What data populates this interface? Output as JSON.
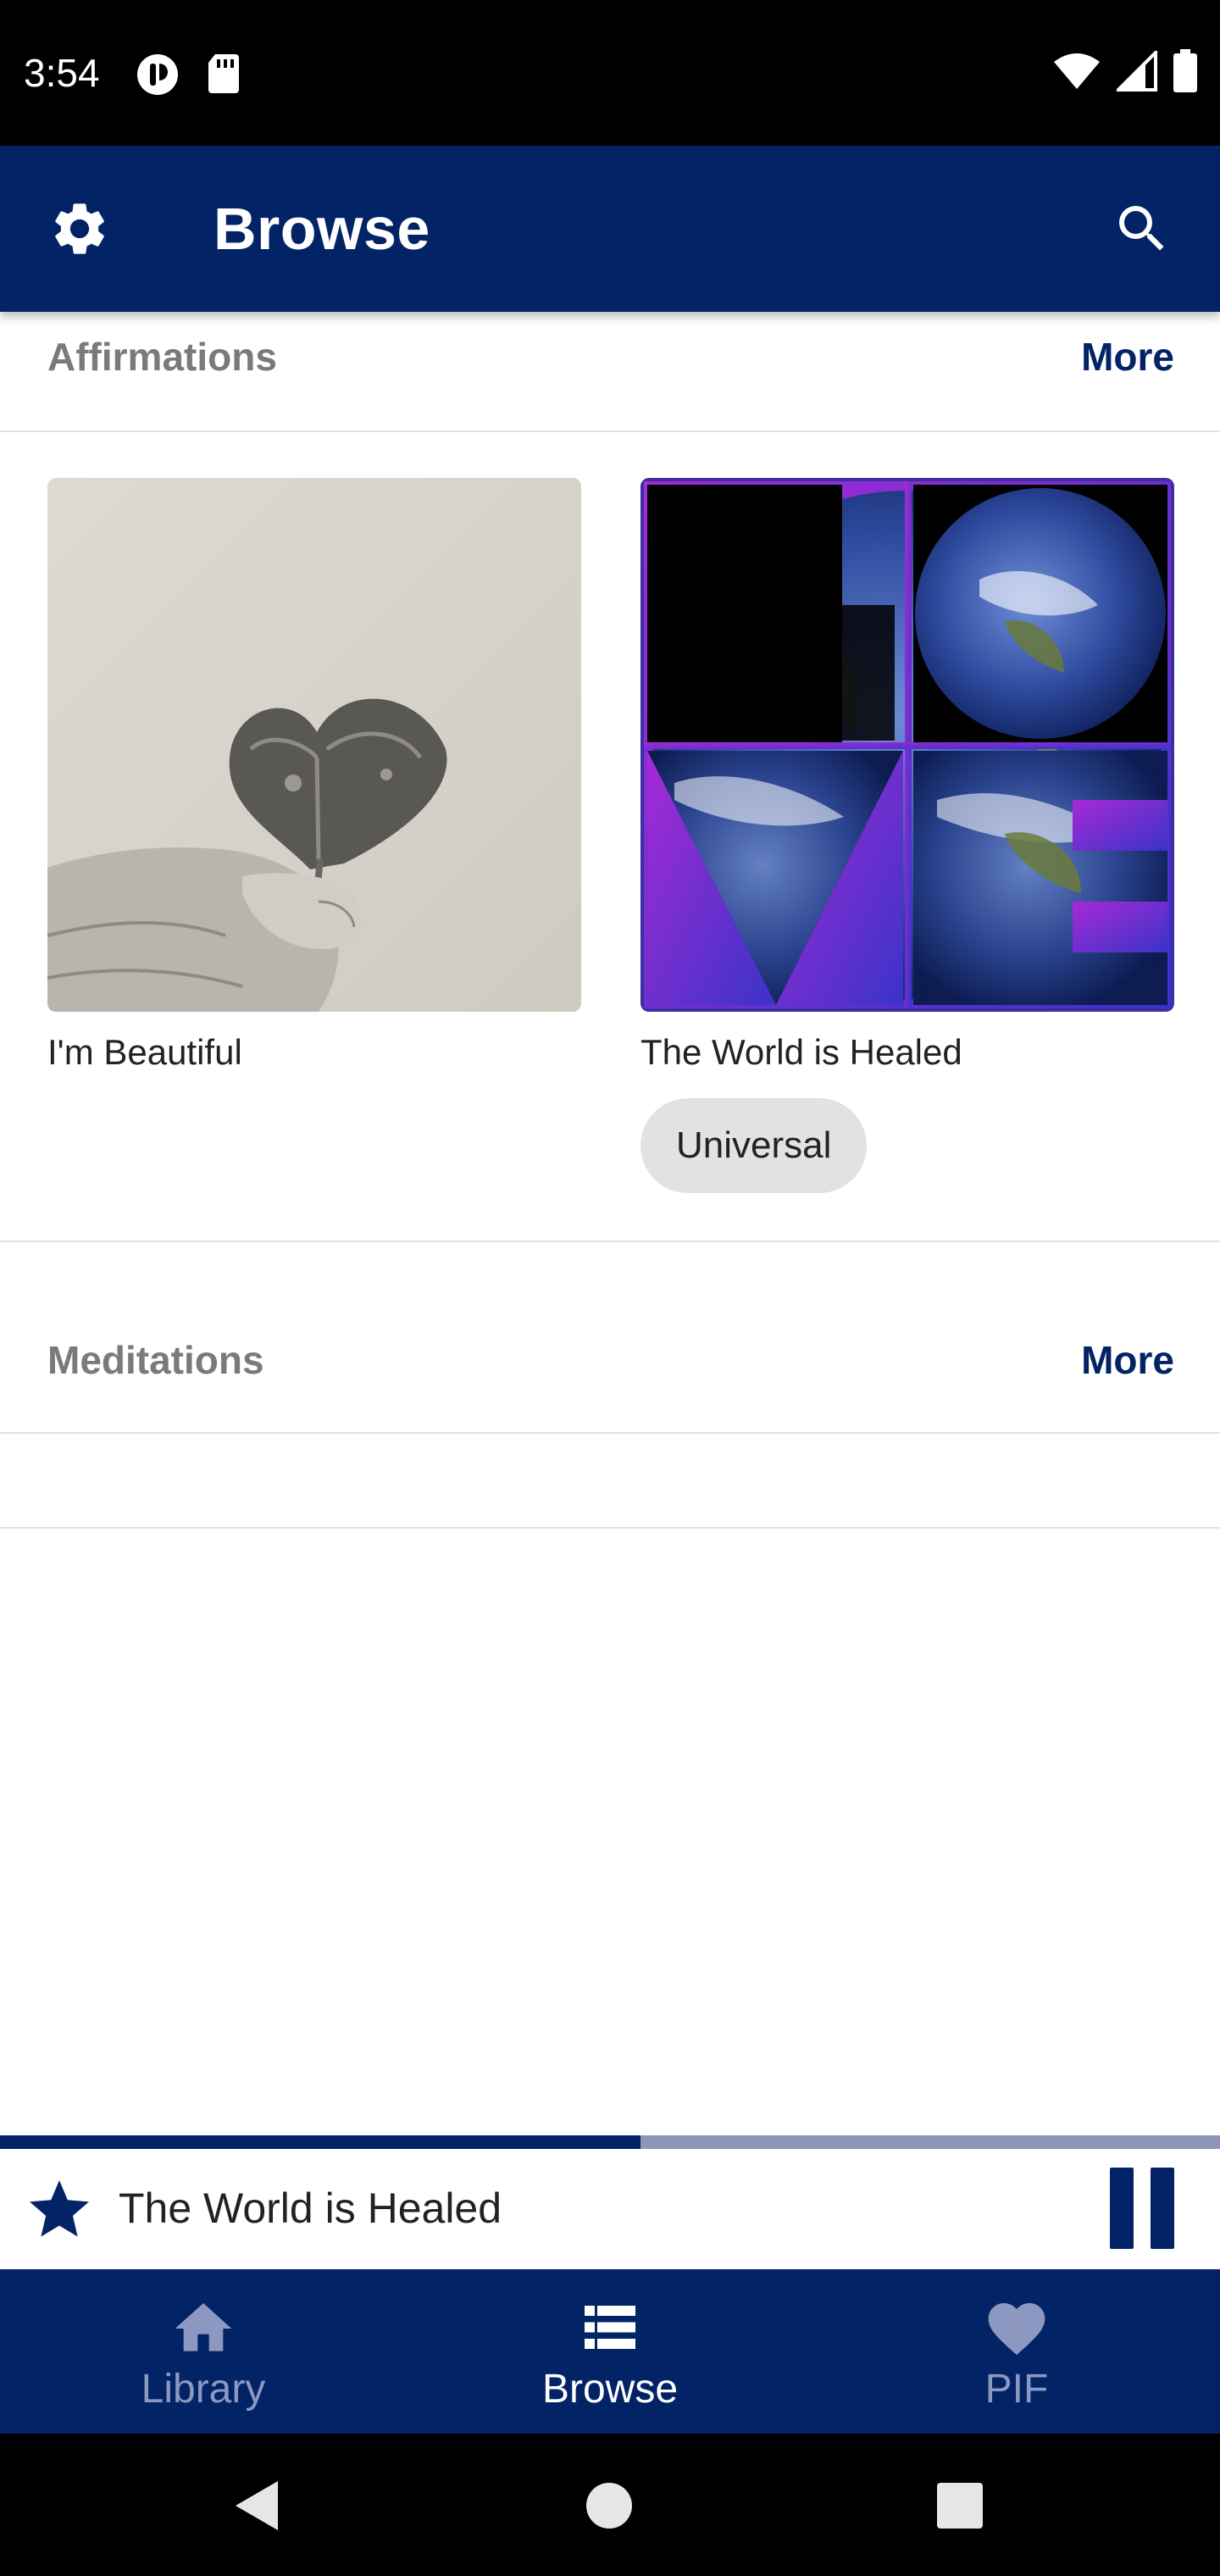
{
  "status_bar": {
    "time": "3:54",
    "left_icons": [
      "notification-app-icon",
      "sd-card-icon"
    ],
    "right_icons": [
      "wifi-icon",
      "cell-signal-icon",
      "battery-icon"
    ]
  },
  "app_bar": {
    "title": "Browse",
    "settings_icon": "gear-icon",
    "search_icon": "search-icon"
  },
  "sections": {
    "affirmations": {
      "title": "Affirmations",
      "more_label": "More",
      "items": [
        {
          "title": "I'm Beautiful",
          "image": "leaf-heart-photo"
        },
        {
          "title": "The World is Healed",
          "image": "love-earth-artwork",
          "chip": "Universal"
        }
      ]
    },
    "meditations": {
      "title": "Meditations",
      "more_label": "More"
    }
  },
  "player": {
    "title": "The World is Healed",
    "progress": 0.525,
    "favorite_icon": "star-icon",
    "pause_icon": "pause-icon"
  },
  "bottom_nav": {
    "items": [
      {
        "label": "Library",
        "icon": "home-icon",
        "active": false
      },
      {
        "label": "Browse",
        "icon": "list-icon",
        "active": true
      },
      {
        "label": "PIF",
        "icon": "heart-icon",
        "active": false
      }
    ]
  },
  "system_nav": [
    "back-icon",
    "home-circle-icon",
    "recents-icon"
  ],
  "colors": {
    "primary": "#022366",
    "inactive_nav": "#8c98bf",
    "section_title": "#7a7a7a",
    "chip_bg": "#e2e2e2"
  }
}
